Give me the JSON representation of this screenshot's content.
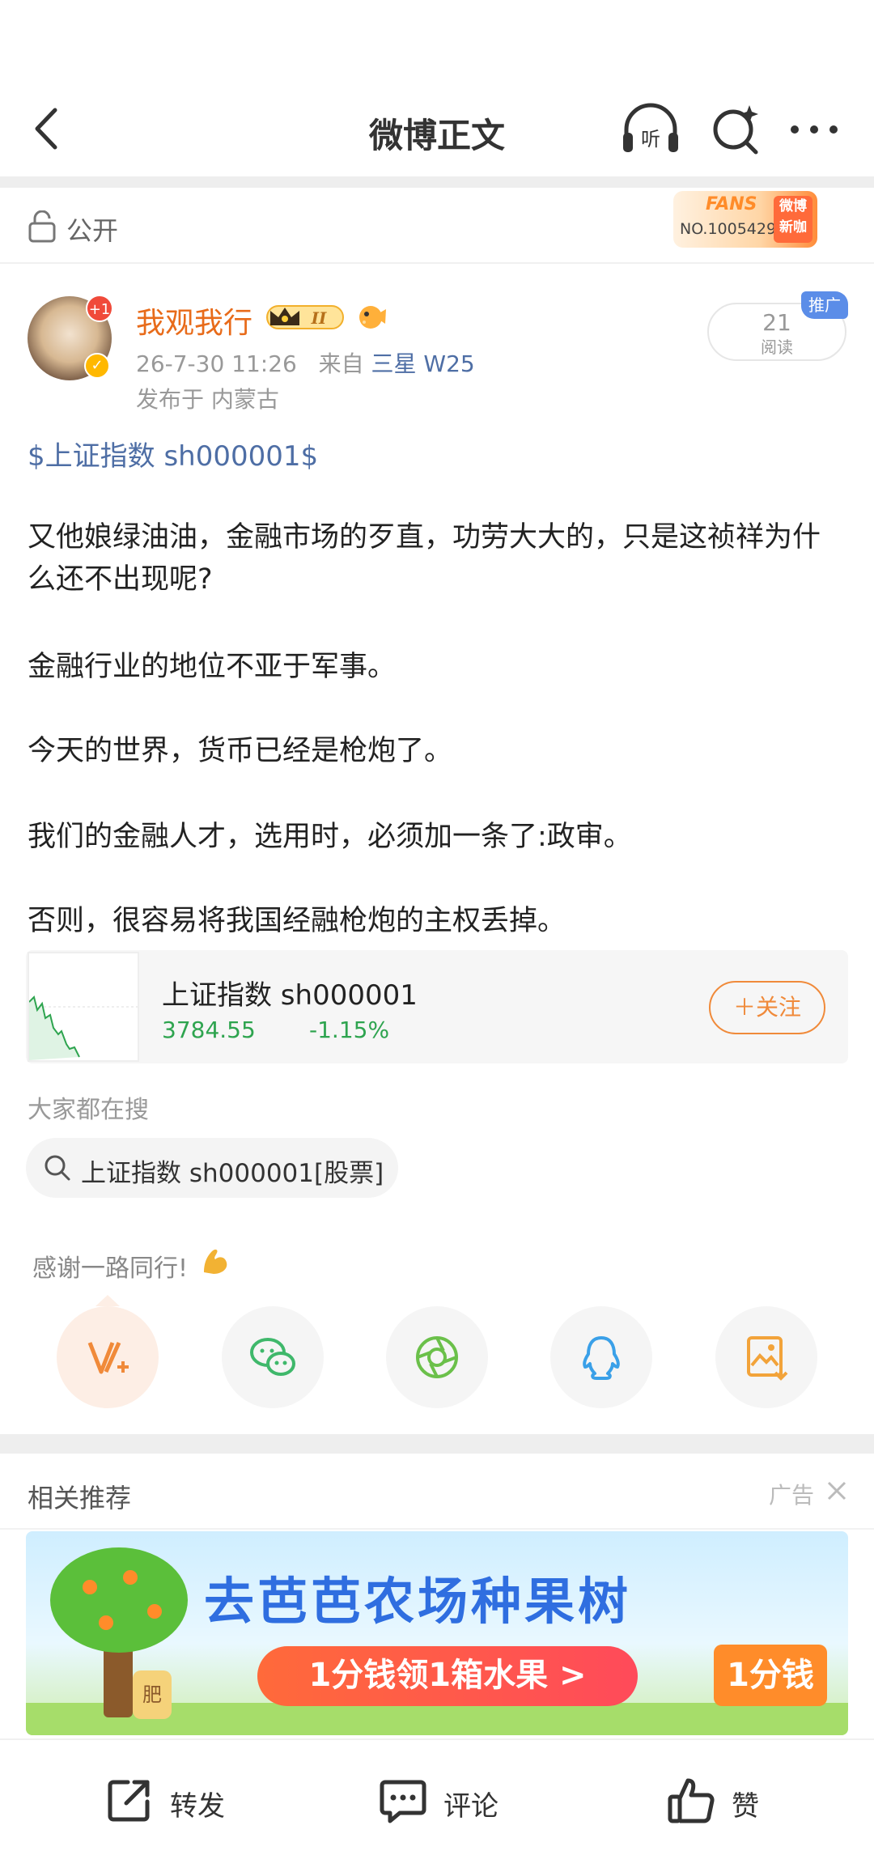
{
  "header": {
    "title": "微博正文",
    "listen_label": "听"
  },
  "visibility": {
    "label": "公开"
  },
  "fans_badge": {
    "top": "FANS",
    "number": "NO.1005429",
    "tag": "微博新咖"
  },
  "post": {
    "author": "我观我行",
    "avatar_badge": "+1",
    "member_level": "II",
    "time": "26-7-30 11:26",
    "source_prefix": "来自",
    "source": "三星 W25",
    "location": "发布于 内蒙古",
    "read_count": "21",
    "read_label": "阅读",
    "promo_label": "推广",
    "topic": "$上证指数 sh000001$",
    "paragraphs": [
      "又他娘绿油油，金融市场的歹直，功劳大大的，只是这祯祥为什么还不出现呢?",
      "金融行业的地位不亚于军事。",
      "今天的世界，货币已经是枪炮了。",
      "我们的金融人才，选用时，必须加一条了:政审。",
      "否则，很容易将我国经融枪炮的主权丢掉。"
    ]
  },
  "stock": {
    "name": "上证指数 sh000001",
    "price": "3784.55",
    "change": "-1.15%",
    "follow_label": "关注",
    "colors": {
      "down": "#2ea44f",
      "follow": "#f08a3a"
    }
  },
  "search": {
    "title": "大家都在搜",
    "chip": "上证指数 sh000001[股票]"
  },
  "thanks": {
    "text": "感谢一路同行!"
  },
  "share": {
    "items": [
      "vplus-icon",
      "wechat-icon",
      "moments-icon",
      "qq-icon",
      "save-image-icon"
    ]
  },
  "related": {
    "title": "相关推荐",
    "ad_label": "广告",
    "banner": {
      "title": "去芭芭农场种果树",
      "cta": "1分钱领1箱水果 >",
      "price_tag": "1分钱",
      "bag_label": "肥"
    }
  },
  "bottom_bar": {
    "repost": "转发",
    "comment": "评论",
    "like": "赞"
  }
}
